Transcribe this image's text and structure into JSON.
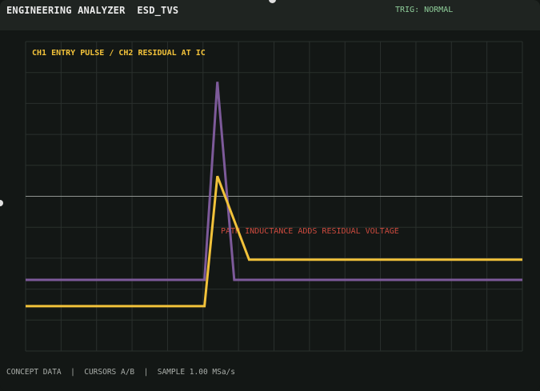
{
  "header": {
    "title": "ENGINEERING ANALYZER  ESD_TVS",
    "trigger": "TRIG: NORMAL"
  },
  "status_bar": {
    "text": "CONCEPT DATA  |  CURSORS A/B  |  SAMPLE 1.00 MSa/s"
  },
  "colors": {
    "ch1": "#f2c23a",
    "ch2": "#7d5a9a",
    "annotation": "#cc4a3e",
    "grid": "#2a302d",
    "zero_line": "#8f9490"
  },
  "chart_data": {
    "type": "line",
    "title": "CH1 ENTRY PULSE / CH2 RESIDUAL AT IC",
    "annotation": "PATH INDUCTANCE ADDS RESIDUAL VOLTAGE",
    "xlim": [
      0,
      100
    ],
    "ylim": [
      -5,
      5
    ],
    "grid": true,
    "zero_line_y": 0,
    "series": [
      {
        "key": "ch1",
        "x": [
          0,
          36,
          38.6,
          45,
          100
        ],
        "y": [
          -3.55,
          -3.55,
          0.65,
          -2.05,
          -2.05
        ]
      },
      {
        "key": "ch2",
        "x": [
          0,
          36,
          38.6,
          42,
          100
        ],
        "y": [
          -2.7,
          -2.7,
          3.7,
          -2.7,
          -2.7
        ]
      }
    ]
  }
}
